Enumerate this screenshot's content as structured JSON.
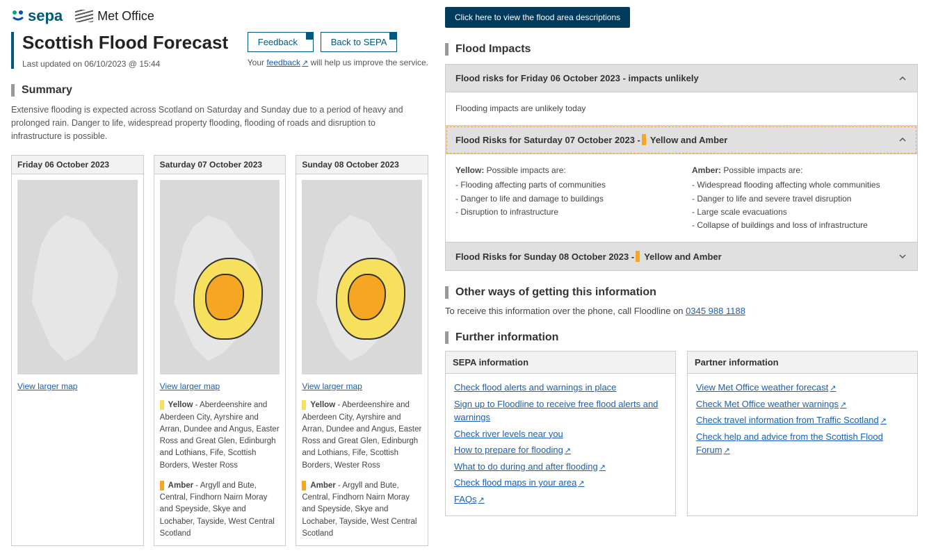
{
  "logos": {
    "sepa": "sepa",
    "met": "Met Office"
  },
  "title": "Scottish Flood Forecast",
  "last_updated": "Last updated on 06/10/2023 @ 15:44",
  "header_buttons": {
    "feedback": "Feedback",
    "back": "Back to SEPA"
  },
  "feedback_note": {
    "pre": "Your ",
    "link": "feedback",
    "post": " will help us improve the service."
  },
  "summary_heading": "Summary",
  "summary_text": "Extensive flooding is expected across Scotland on Saturday and Sunday due to a period of heavy and prolonged rain. Danger to life, widespread property flooding, flooding of roads and disruption to infrastructure is possible.",
  "maps": [
    {
      "date": "Friday 06 October 2023",
      "view_larger": "View larger map",
      "has_alerts": false
    },
    {
      "date": "Saturday 07 October 2023",
      "view_larger": "View larger map",
      "has_alerts": true,
      "yellow_label": "Yellow",
      "yellow_areas": " - Aberdeenshire and Aberdeen City, Ayrshire and Arran, Dundee and Angus, Easter Ross and Great Glen, Edinburgh and Lothians, Fife, Scottish Borders, Wester Ross",
      "amber_label": "Amber",
      "amber_areas": " - Argyll and Bute, Central, Findhorn Nairn Moray and Speyside, Skye and Lochaber, Tayside, West Central Scotland"
    },
    {
      "date": "Sunday 08 October 2023",
      "view_larger": "View larger map",
      "has_alerts": true,
      "yellow_label": "Yellow",
      "yellow_areas": " - Aberdeenshire and Aberdeen City, Ayrshire and Arran, Dundee and Angus, Easter Ross and Great Glen, Edinburgh and Lothians, Fife, Scottish Borders, Wester Ross",
      "amber_label": "Amber",
      "amber_areas": " - Argyll and Bute, Central, Findhorn Nairn Moray and Speyside, Skye and Lochaber, Tayside, West Central Scotland"
    }
  ],
  "area_desc_btn": "Click here to view the flood area descriptions",
  "impacts_heading": "Flood Impacts",
  "accordion": {
    "friday": {
      "title": "Flood risks for Friday 06 October 2023 - impacts unlikely",
      "body": "Flooding impacts are unlikely today"
    },
    "saturday": {
      "title_pre": "Flood Risks for Saturday 07 October 2023 - ",
      "title_post": "Yellow and Amber",
      "yellow_lead": "Yellow:",
      "yellow_intro": " Possible impacts are:",
      "yellow_items": [
        "Flooding affecting parts of communities",
        "Danger to life and damage to buildings",
        "Disruption to infrastructure"
      ],
      "amber_lead": "Amber:",
      "amber_intro": " Possible impacts are:",
      "amber_items": [
        "Widespread flooding affecting whole communities",
        "Danger to life and severe travel disruption",
        "Large scale evacuations",
        "Collapse of buildings and loss of infrastructure"
      ]
    },
    "sunday": {
      "title_pre": "Flood Risks for Sunday 08 October 2023 - ",
      "title_post": "Yellow and Amber"
    }
  },
  "other_ways_heading": "Other ways of getting this information",
  "phone_pre": "To receive this information over the phone, call Floodline on ",
  "phone_number": "0345 988 1188",
  "further_heading": "Further information",
  "sepa_info": {
    "header": "SEPA information",
    "links": [
      "Check flood alerts and warnings in place",
      "Sign up to Floodline to receive free flood alerts and warnings",
      "Check river levels near you",
      "How to prepare for flooding",
      "What to do during and after flooding",
      "Check flood maps in your area",
      "FAQs"
    ],
    "ext_flags": [
      false,
      false,
      false,
      true,
      true,
      true,
      true
    ]
  },
  "partner_info": {
    "header": "Partner information",
    "links": [
      "View Met Office weather forecast",
      "Check Met Office weather warnings",
      "Check travel information from Traffic Scotland",
      "Check help and advice from the Scottish Flood Forum"
    ]
  }
}
